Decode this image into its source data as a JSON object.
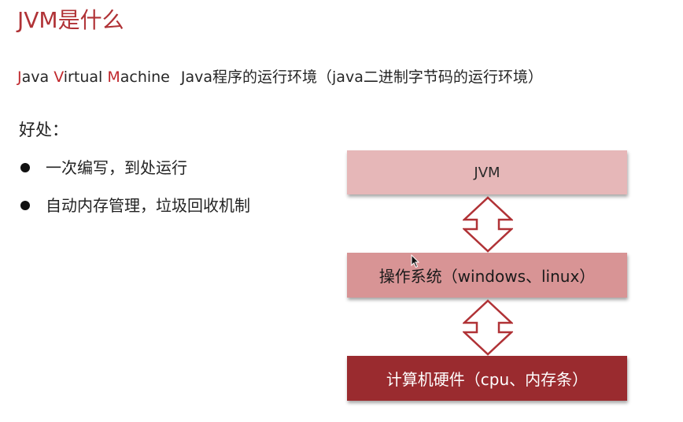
{
  "title": "JVM是什么",
  "subtitle": {
    "j_cap": "J",
    "j_rest": "ava ",
    "v_cap": "V",
    "v_rest": "irtual ",
    "m_cap": "M",
    "m_rest": "achine",
    "description": "Java程序的运行环境（java二进制字节码的运行环境）"
  },
  "benefits": {
    "label": "好处：",
    "items": [
      "一次编写，到处运行",
      "自动内存管理，垃圾回收机制"
    ]
  },
  "diagram": {
    "layers": [
      "JVM",
      "操作系统（windows、linux）",
      "计算机硬件（cpu、内存条）"
    ]
  },
  "colors": {
    "accent": "#b03236",
    "jvm_layer": "#e6b7b8",
    "os_layer": "#d89495",
    "hardware_layer": "#9a2b2f"
  },
  "icons": [
    "double-headed-arrow-icon",
    "mouse-cursor-icon"
  ]
}
